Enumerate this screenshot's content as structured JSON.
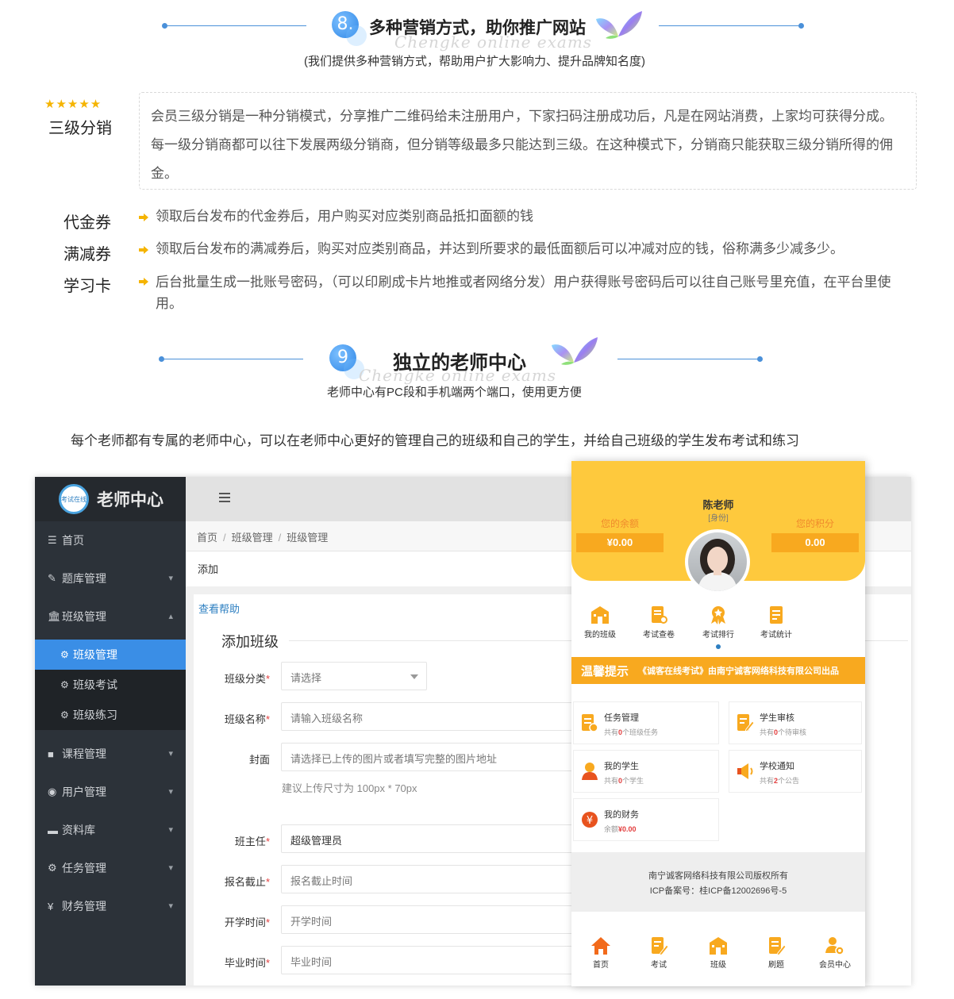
{
  "section8": {
    "number": "8.",
    "title": "多种营销方式，助你推广网站",
    "watermark": "Chengke online exams",
    "subtitle": "(我们提供多种营销方式，帮助用户扩大影响力、提升品牌知名度)"
  },
  "distribution": {
    "stars": "★★★★★",
    "label": "三级分销",
    "text": "会员三级分销是一种分销模式，分享推广二维码给未注册用户，下家扫码注册成功后，凡是在网站消费，上家均可获得分成。每一级分销商都可以往下发展两级分销商，但分销等级最多只能达到三级。在这种模式下，分销商只能获取三级分销所得的佣金。"
  },
  "features": [
    {
      "label": "代金券",
      "text": "领取后台发布的代金券后，用户购买对应类别商品抵扣面额的钱"
    },
    {
      "label": "满减券",
      "text": "领取后台发布的满减券后，购买对应类别商品，并达到所要求的最低面额后可以冲减对应的钱，俗称满多少减多少。"
    },
    {
      "label": "学习卡",
      "text": "后台批量生成一批账号密码，（可以印刷成卡片地推或者网络分发）用户获得账号密码后可以往自己账号里充值，在平台里使用。"
    }
  ],
  "section9": {
    "number": "9",
    "title": "独立的老师中心",
    "watermark": "Chengke online exams",
    "subtitle": "老师中心有PC段和手机端两个端口，使用更方便"
  },
  "intro": "每个老师都有专属的老师中心，可以在老师中心更好的管理自己的班级和自己的学生，并给自己班级的学生发布考试和练习",
  "admin": {
    "logo_badge": "考试在线",
    "logo_title": "老师中心",
    "menu": [
      {
        "icon": "list-icon",
        "label": "首页",
        "chevron": ""
      },
      {
        "icon": "edit-icon",
        "label": "题库管理",
        "chevron": "⌄"
      },
      {
        "icon": "bank-icon",
        "label": "班级管理",
        "chevron": "⌃"
      }
    ],
    "submenu": [
      {
        "label": "班级管理",
        "active": true
      },
      {
        "label": "班级考试",
        "active": false
      },
      {
        "label": "班级练习",
        "active": false
      }
    ],
    "menu2": [
      {
        "icon": "video-icon",
        "label": "课程管理",
        "chevron": "⌄"
      },
      {
        "icon": "user-icon",
        "label": "用户管理",
        "chevron": "⌄"
      },
      {
        "icon": "briefcase-icon",
        "label": "资料库",
        "chevron": "⌄"
      },
      {
        "icon": "gear-icon",
        "label": "任务管理",
        "chevron": "⌄"
      },
      {
        "icon": "yen-icon",
        "label": "财务管理",
        "chevron": "⌄"
      }
    ],
    "breadcrumb": [
      "首页",
      "班级管理",
      "班级管理"
    ],
    "add_label": "添加",
    "help_link": "查看帮助",
    "form_title": "添加班级",
    "fields": {
      "category": {
        "label": "班级分类",
        "value": "请选择"
      },
      "name": {
        "label": "班级名称",
        "placeholder": "请输入班级名称"
      },
      "cover": {
        "label": "封面",
        "placeholder": "请选择已上传的图片或者填写完整的图片地址",
        "hint": "建议上传尺寸为 100px * 70px"
      },
      "teacher": {
        "label": "班主任",
        "value": "超级管理员"
      },
      "deadline": {
        "label": "报名截止",
        "placeholder": "报名截止时间"
      },
      "start": {
        "label": "开学时间",
        "placeholder": "开学时间"
      },
      "end": {
        "label": "毕业时间",
        "placeholder": "毕业时间"
      }
    },
    "required_mark": "*"
  },
  "mobile": {
    "name": "陈老师",
    "role": "[身份]",
    "balance_label": "您的余额",
    "balance_value": "¥0.00",
    "points_label": "您的积分",
    "points_value": "0.00",
    "quick": [
      "我的班级",
      "考试查卷",
      "考试排行",
      "考试统计"
    ],
    "notice_title": "温馨提示",
    "notice_text": "《诚客在线考试》由南宁诚客网络科技有限公司出品",
    "cards": [
      {
        "title": "任务管理",
        "pre": "共有",
        "count": "0",
        "post": "个班级任务"
      },
      {
        "title": "学生审核",
        "pre": "共有",
        "count": "0",
        "post": "个待审核"
      },
      {
        "title": "我的学生",
        "pre": "共有",
        "count": "0",
        "post": "个学生"
      },
      {
        "title": "学校通知",
        "pre": "共有",
        "count": "2",
        "post": "个公告"
      },
      {
        "title": "我的财务",
        "pre": "余额",
        "count": "¥0.00",
        "post": ""
      }
    ],
    "footer_line1": "南宁诚客网络科技有限公司版权所有",
    "footer_line2": "ICP备案号：桂ICP备12002696号-5",
    "tabs": [
      "首页",
      "考试",
      "班级",
      "刷题",
      "会员中心"
    ]
  },
  "colors": {
    "accent_blue": "#3a8ee6",
    "mobile_yellow": "#fec93d",
    "mobile_orange": "#f8a91f",
    "sidebar_dark": "#2c3239",
    "star_gold": "#f5b400"
  }
}
